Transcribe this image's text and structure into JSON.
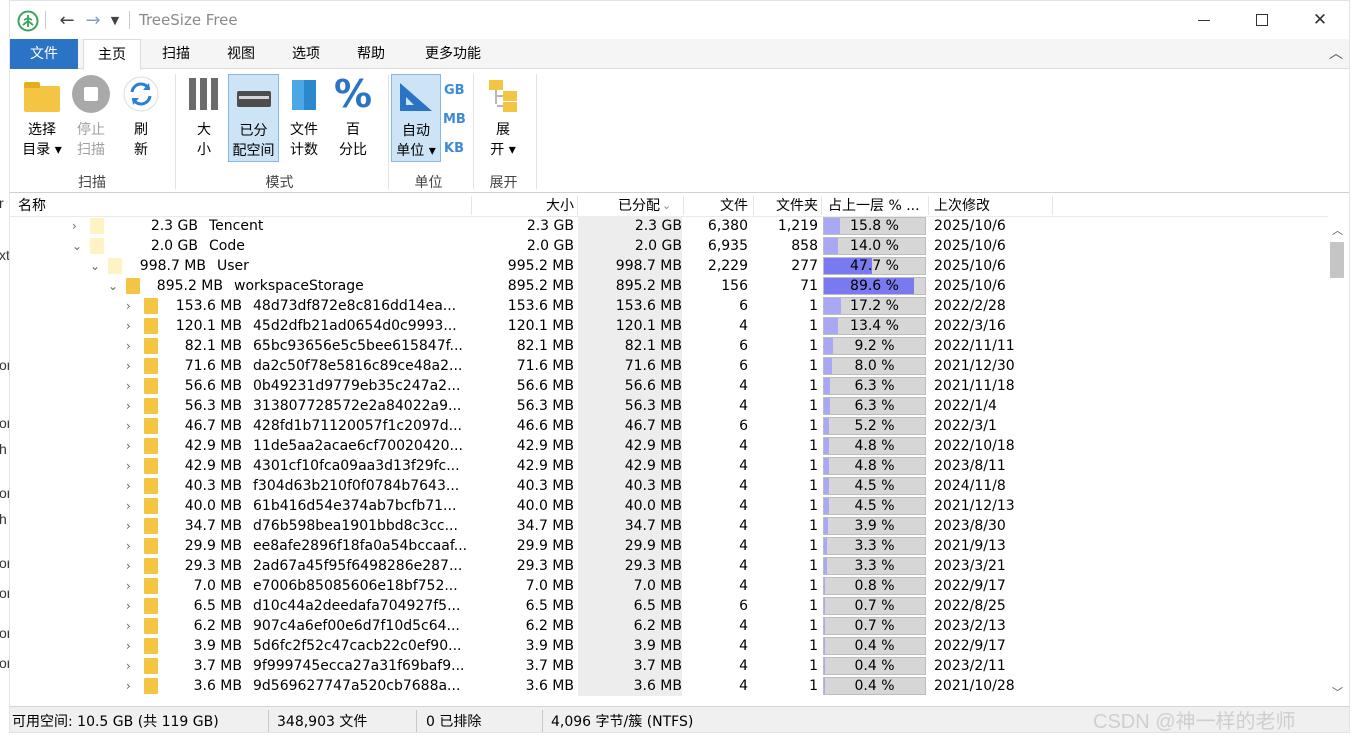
{
  "window": {
    "title": "TreeSize Free"
  },
  "menu": {
    "file": "文件",
    "tabs": [
      "主页",
      "扫描",
      "视图",
      "选项",
      "帮助",
      "更多功能"
    ]
  },
  "ribbon": {
    "buttons": [
      {
        "l1": "选择",
        "l2": "目录 ▾"
      },
      {
        "l1": "停止",
        "l2": "扫描"
      },
      {
        "l1": "刷",
        "l2": "新"
      },
      {
        "l1": "大",
        "l2": "小"
      },
      {
        "l1": "已分",
        "l2": "配空间"
      },
      {
        "l1": "文件",
        "l2": "计数"
      },
      {
        "l1": "百",
        "l2": "分比"
      },
      {
        "l1": "自动",
        "l2": "单位 ▾"
      },
      {
        "l1": "展",
        "l2": "开 ▾"
      }
    ],
    "units": [
      "GB",
      "MB",
      "KB"
    ],
    "groups": [
      "扫描",
      "模式",
      "单位",
      "展开"
    ]
  },
  "columns": [
    "名称",
    "大小",
    "已分配",
    "文件",
    "文件夹",
    "占上一层 % ...",
    "上次修改"
  ],
  "rows": [
    {
      "d": 1,
      "e": "›",
      "sz": "2.3 GB",
      "nm": "Tencent",
      "size": "2.3 GB",
      "alloc": "2.3 GB",
      "files": "6,380",
      "folders": "1,219",
      "pct": 15.8,
      "p": "15.8 %",
      "mod": "2025/10/6"
    },
    {
      "d": 1,
      "e": "⌄",
      "sz": "2.0 GB",
      "nm": "Code",
      "size": "2.0 GB",
      "alloc": "2.0 GB",
      "files": "6,935",
      "folders": "858",
      "pct": 14.0,
      "p": "14.0 %",
      "mod": "2025/10/6"
    },
    {
      "d": 2,
      "e": "⌄",
      "sz": "998.7 MB",
      "nm": "User",
      "size": "995.2 MB",
      "alloc": "998.7 MB",
      "files": "2,229",
      "folders": "277",
      "pct": 47.7,
      "p": "47.7 %",
      "mod": "2025/10/6"
    },
    {
      "d": 3,
      "e": "⌄",
      "sz": "895.2 MB",
      "nm": "workspaceStorage",
      "size": "895.2 MB",
      "alloc": "895.2 MB",
      "files": "156",
      "folders": "71",
      "pct": 89.6,
      "p": "89.6 %",
      "mod": "2025/10/6"
    },
    {
      "d": 4,
      "e": "›",
      "sz": "153.6 MB",
      "nm": "48d73df872e8c816dd14ea...",
      "size": "153.6 MB",
      "alloc": "153.6 MB",
      "files": "6",
      "folders": "1",
      "pct": 17.2,
      "p": "17.2 %",
      "mod": "2022/2/28"
    },
    {
      "d": 4,
      "e": "›",
      "sz": "120.1 MB",
      "nm": "45d2dfb21ad0654d0c9993...",
      "size": "120.1 MB",
      "alloc": "120.1 MB",
      "files": "4",
      "folders": "1",
      "pct": 13.4,
      "p": "13.4 %",
      "mod": "2022/3/16"
    },
    {
      "d": 4,
      "e": "›",
      "sz": "82.1 MB",
      "nm": "65bc93656e5c5bee615847f...",
      "size": "82.1 MB",
      "alloc": "82.1 MB",
      "files": "6",
      "folders": "1",
      "pct": 9.2,
      "p": "9.2 %",
      "mod": "2022/11/11"
    },
    {
      "d": 4,
      "e": "›",
      "sz": "71.6 MB",
      "nm": "da2c50f78e5816c89ce48a2...",
      "size": "71.6 MB",
      "alloc": "71.6 MB",
      "files": "6",
      "folders": "1",
      "pct": 8.0,
      "p": "8.0 %",
      "mod": "2021/12/30"
    },
    {
      "d": 4,
      "e": "›",
      "sz": "56.6 MB",
      "nm": "0b49231d9779eb35c247a2...",
      "size": "56.6 MB",
      "alloc": "56.6 MB",
      "files": "4",
      "folders": "1",
      "pct": 6.3,
      "p": "6.3 %",
      "mod": "2021/11/18"
    },
    {
      "d": 4,
      "e": "›",
      "sz": "56.3 MB",
      "nm": "313807728572e2a84022a9...",
      "size": "56.3 MB",
      "alloc": "56.3 MB",
      "files": "4",
      "folders": "1",
      "pct": 6.3,
      "p": "6.3 %",
      "mod": "2022/1/4"
    },
    {
      "d": 4,
      "e": "›",
      "sz": "46.7 MB",
      "nm": "428fd1b71120057f1c2097d...",
      "size": "46.6 MB",
      "alloc": "46.7 MB",
      "files": "6",
      "folders": "1",
      "pct": 5.2,
      "p": "5.2 %",
      "mod": "2022/3/1"
    },
    {
      "d": 4,
      "e": "›",
      "sz": "42.9 MB",
      "nm": "11de5aa2acae6cf70020420...",
      "size": "42.9 MB",
      "alloc": "42.9 MB",
      "files": "4",
      "folders": "1",
      "pct": 4.8,
      "p": "4.8 %",
      "mod": "2022/10/18"
    },
    {
      "d": 4,
      "e": "›",
      "sz": "42.9 MB",
      "nm": "4301cf10fca09aa3d13f29fc...",
      "size": "42.9 MB",
      "alloc": "42.9 MB",
      "files": "4",
      "folders": "1",
      "pct": 4.8,
      "p": "4.8 %",
      "mod": "2023/8/11"
    },
    {
      "d": 4,
      "e": "›",
      "sz": "40.3 MB",
      "nm": "f304d63b210f0f0784b7643...",
      "size": "40.3 MB",
      "alloc": "40.3 MB",
      "files": "4",
      "folders": "1",
      "pct": 4.5,
      "p": "4.5 %",
      "mod": "2024/11/8"
    },
    {
      "d": 4,
      "e": "›",
      "sz": "40.0 MB",
      "nm": "61b416d54e374ab7bcfb71...",
      "size": "40.0 MB",
      "alloc": "40.0 MB",
      "files": "4",
      "folders": "1",
      "pct": 4.5,
      "p": "4.5 %",
      "mod": "2021/12/13"
    },
    {
      "d": 4,
      "e": "›",
      "sz": "34.7 MB",
      "nm": "d76b598bea1901bbd8c3cc...",
      "size": "34.7 MB",
      "alloc": "34.7 MB",
      "files": "4",
      "folders": "1",
      "pct": 3.9,
      "p": "3.9 %",
      "mod": "2023/8/30"
    },
    {
      "d": 4,
      "e": "›",
      "sz": "29.9 MB",
      "nm": "ee8afe2896f18fa0a54bccaaf...",
      "size": "29.9 MB",
      "alloc": "29.9 MB",
      "files": "4",
      "folders": "1",
      "pct": 3.3,
      "p": "3.3 %",
      "mod": "2021/9/13"
    },
    {
      "d": 4,
      "e": "›",
      "sz": "29.3 MB",
      "nm": "2ad67a45f95f6498286e287...",
      "size": "29.3 MB",
      "alloc": "29.3 MB",
      "files": "4",
      "folders": "1",
      "pct": 3.3,
      "p": "3.3 %",
      "mod": "2023/3/21"
    },
    {
      "d": 4,
      "e": "›",
      "sz": "7.0 MB",
      "nm": "e7006b85085606e18bf752...",
      "size": "7.0 MB",
      "alloc": "7.0 MB",
      "files": "4",
      "folders": "1",
      "pct": 0.8,
      "p": "0.8 %",
      "mod": "2022/9/17"
    },
    {
      "d": 4,
      "e": "›",
      "sz": "6.5 MB",
      "nm": "d10c44a2deedafa704927f5...",
      "size": "6.5 MB",
      "alloc": "6.5 MB",
      "files": "6",
      "folders": "1",
      "pct": 0.7,
      "p": "0.7 %",
      "mod": "2022/8/25"
    },
    {
      "d": 4,
      "e": "›",
      "sz": "6.2 MB",
      "nm": "907c4a6ef00e6d7f10d5c64...",
      "size": "6.2 MB",
      "alloc": "6.2 MB",
      "files": "4",
      "folders": "1",
      "pct": 0.7,
      "p": "0.7 %",
      "mod": "2023/2/13"
    },
    {
      "d": 4,
      "e": "›",
      "sz": "3.9 MB",
      "nm": "5d6fc2f52c47cacb22c0ef90...",
      "size": "3.9 MB",
      "alloc": "3.9 MB",
      "files": "4",
      "folders": "1",
      "pct": 0.4,
      "p": "0.4 %",
      "mod": "2022/9/17"
    },
    {
      "d": 4,
      "e": "›",
      "sz": "3.7 MB",
      "nm": "9f999745ecca27a31f69baf9...",
      "size": "3.7 MB",
      "alloc": "3.7 MB",
      "files": "4",
      "folders": "1",
      "pct": 0.4,
      "p": "0.4 %",
      "mod": "2023/2/11"
    },
    {
      "d": 4,
      "e": "›",
      "sz": "3.6 MB",
      "nm": "9d569627747a520cb7688a...",
      "size": "3.6 MB",
      "alloc": "3.6 MB",
      "files": "4",
      "folders": "1",
      "pct": 0.4,
      "p": "0.4 %",
      "mod": "2021/10/28"
    }
  ],
  "status": {
    "free": "可用空间: 10.5 GB (共 119 GB)",
    "files": "348,903 文件",
    "excluded": "0 已排除",
    "cluster": "4,096 字节/簇 (NTFS)"
  },
  "watermark": "CSDN @神一样的老师",
  "desktop": [
    "r",
    "xt",
    "or",
    "or",
    "h",
    "or",
    "h",
    "or",
    "or",
    "or",
    "or"
  ],
  "colors": {
    "accent": "#2b73c5",
    "bar": "#a8a8f5",
    "barBg": "#d6d6d6",
    "selected": "#cde4f7",
    "folder": "#f4c443"
  }
}
